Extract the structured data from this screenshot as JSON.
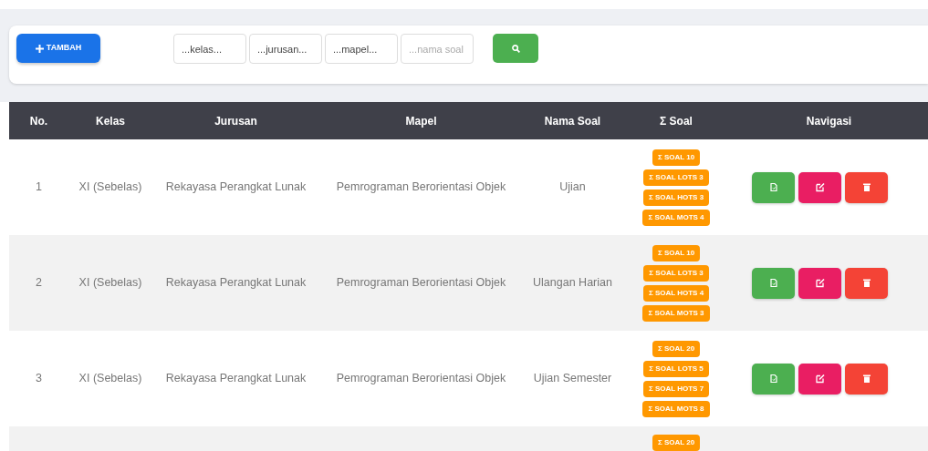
{
  "toolbar": {
    "add_button": "TAMBAH",
    "filters": [
      {
        "kind": "select",
        "value": "...kelas..."
      },
      {
        "kind": "select",
        "value": "...jurusan..."
      },
      {
        "kind": "select",
        "value": "...mapel..."
      },
      {
        "kind": "input",
        "placeholder": "...nama soal"
      }
    ]
  },
  "table": {
    "columns": [
      "No.",
      "Kelas",
      "Jurusan",
      "Mapel",
      "Nama Soal",
      "Σ Soal",
      "Navigasi"
    ],
    "rows": [
      {
        "no": "1",
        "kelas": "XI (Sebelas)",
        "jurusan": "Rekayasa Perangkat Lunak",
        "mapel": "Pemrograman Berorientasi Objek",
        "nama_soal": "Ujian",
        "badges": [
          "Σ SOAL 10",
          "Σ SOAL LOTS 3",
          "Σ SOAL HOTS 3",
          "Σ SOAL MOTS 4"
        ],
        "actions": true
      },
      {
        "no": "2",
        "kelas": "XI (Sebelas)",
        "jurusan": "Rekayasa Perangkat Lunak",
        "mapel": "Pemrograman Berorientasi Objek",
        "nama_soal": "Ulangan Harian",
        "badges": [
          "Σ SOAL 10",
          "Σ SOAL LOTS 3",
          "Σ SOAL HOTS 4",
          "Σ SOAL MOTS 3"
        ],
        "actions": true
      },
      {
        "no": "3",
        "kelas": "XI (Sebelas)",
        "jurusan": "Rekayasa Perangkat Lunak",
        "mapel": "Pemrograman Berorientasi Objek",
        "nama_soal": "Ujian Semester",
        "badges": [
          "Σ SOAL 20",
          "Σ SOAL LOTS 5",
          "Σ SOAL HOTS 7",
          "Σ SOAL MOTS 8"
        ],
        "actions": true
      },
      {
        "badges": [
          "Σ SOAL 20"
        ],
        "actions": false
      }
    ]
  }
}
